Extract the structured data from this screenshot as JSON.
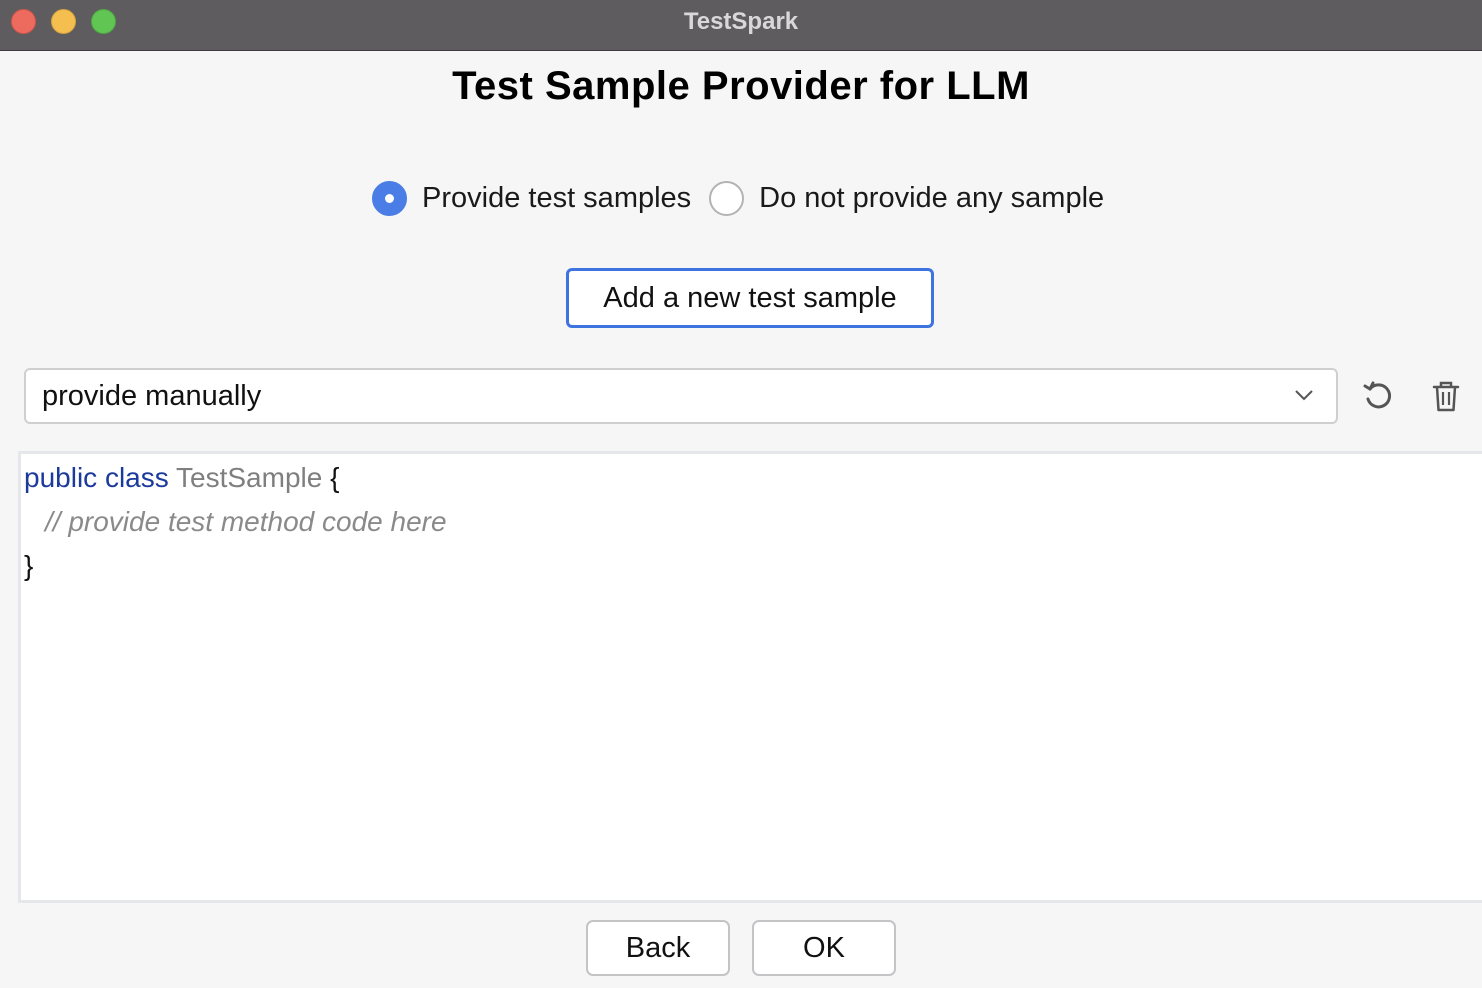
{
  "window": {
    "title": "TestSpark",
    "traffic_lights": [
      "close",
      "minimize",
      "zoom"
    ]
  },
  "heading": "Test Sample Provider for LLM",
  "radio": {
    "options": [
      {
        "label": "Provide test samples",
        "selected": true
      },
      {
        "label": "Do not provide any sample",
        "selected": false
      }
    ]
  },
  "add_button_label": "Add a new test sample",
  "sample_select": {
    "value": "provide manually",
    "icon": "chevron-down-icon"
  },
  "actions": {
    "reset_icon": "reset-icon",
    "delete_icon": "trash-icon"
  },
  "editor": {
    "line1_keyword": "public class",
    "line1_class": "TestSample",
    "line1_brace": "{",
    "line2_comment": "// provide test method code here",
    "line3_brace": "}"
  },
  "footer": {
    "back_label": "Back",
    "ok_label": "OK"
  },
  "colors": {
    "accent": "#4a7de5",
    "keyword": "#1b3a9c",
    "comment": "#8a8a8a",
    "titlebar": "#5e5c5e"
  }
}
